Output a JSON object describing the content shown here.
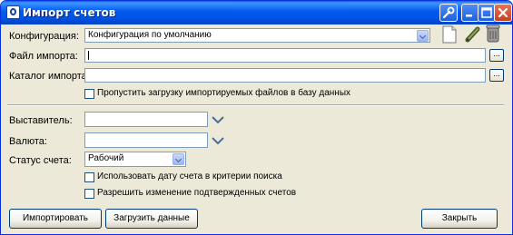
{
  "window": {
    "title": "Импорт счетов"
  },
  "form": {
    "config_label": "Конфигурация:",
    "config_value": "Конфигурация по умолчанию",
    "import_file_label": "Файл импорта:",
    "import_file_value": "",
    "import_dir_label": "Каталог импорта:",
    "import_dir_value": "",
    "browse_label": "...",
    "skip_loaded_label": "Пропустить загрузку импортируемых файлов в базу данных",
    "issuer_label": "Выставитель:",
    "issuer_value": "",
    "currency_label": "Валюта:",
    "currency_value": "",
    "status_label": "Статус счета:",
    "status_value": "Рабочий",
    "use_date_label": "Использовать дату счета в критерии поиска",
    "allow_change_label": "Разрешить изменение подтвержденных счетов"
  },
  "buttons": {
    "import": "Импортировать",
    "load_data": "Загрузить данные",
    "close": "Закрыть"
  },
  "icons": [
    "app-icon",
    "tools-icon",
    "minimize-icon",
    "maximize-icon",
    "close-icon",
    "new-document-icon",
    "edit-pen-icon",
    "trash-icon",
    "chevron-down-icon"
  ]
}
